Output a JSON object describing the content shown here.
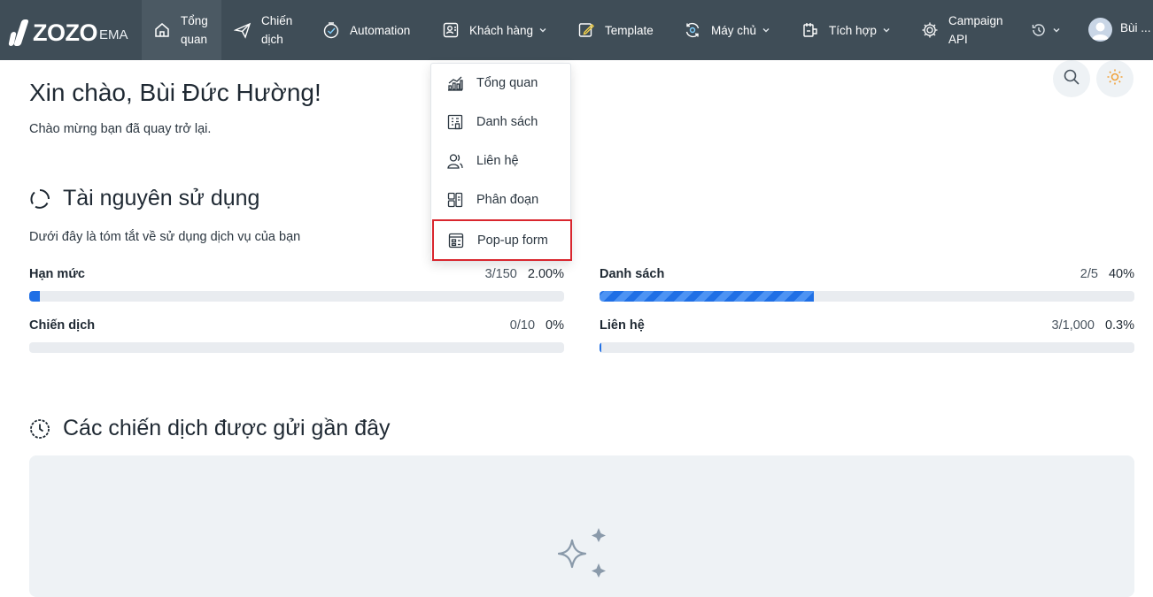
{
  "brand": {
    "logo_text": "ZOZO",
    "logo_suffix": "EMA"
  },
  "nav": {
    "items": [
      {
        "label_line1": "Tổng",
        "label_line2": "quan"
      },
      {
        "label_line1": "Chiến",
        "label_line2": "dịch"
      },
      {
        "label": "Automation"
      },
      {
        "label": "Khách hàng"
      },
      {
        "label": "Template"
      },
      {
        "label": "Máy chủ"
      },
      {
        "label": "Tích hợp"
      },
      {
        "label_line1": "Campaign",
        "label_line2": "API"
      }
    ],
    "user_name": "Bùi ..."
  },
  "dropdown": {
    "items": [
      {
        "label": "Tổng quan",
        "icon": "chart-bar-icon"
      },
      {
        "label": "Danh sách",
        "icon": "list-building-icon"
      },
      {
        "label": "Liên hệ",
        "icon": "contacts-icon"
      },
      {
        "label": "Phân đoạn",
        "icon": "segments-icon"
      },
      {
        "label": "Pop-up form",
        "icon": "popup-form-icon",
        "highlighted": true
      }
    ]
  },
  "main": {
    "greeting": "Xin chào, Bùi Đức Hường!",
    "welcome": "Chào mừng bạn đã quay trở lại.",
    "usage_section": {
      "title": "Tài nguyên sử dụng",
      "subtitle": "Dưới đây là tóm tắt về sử dụng dịch vụ của bạn",
      "items": [
        {
          "name": "Hạn mức",
          "count": "3/150",
          "percent": "2.00%",
          "fraction": 0.02
        },
        {
          "name": "Danh sách",
          "count": "2/5",
          "percent": "40%",
          "fraction": 0.4
        },
        {
          "name": "Chiến dịch",
          "count": "0/10",
          "percent": "0%",
          "fraction": 0.0
        },
        {
          "name": "Liên hệ",
          "count": "3/1,000",
          "percent": "0.3%",
          "fraction": 0.003
        }
      ]
    },
    "recent_section": {
      "title": "Các chiến dịch được gửi gần đây"
    }
  },
  "colors": {
    "nav_bg": "#3f4d57",
    "accent": "#1f6fe5",
    "highlight_border": "#d9262e",
    "empty_bg": "#eef2f5"
  }
}
